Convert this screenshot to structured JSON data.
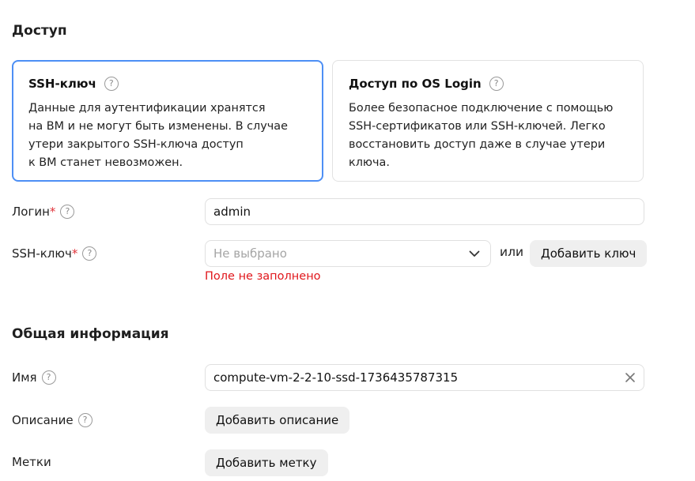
{
  "access": {
    "title": "Доступ",
    "cards": [
      {
        "title": "SSH-ключ",
        "description": "Данные для аутентификации хранятся\nна ВМ и не могут быть изменены. В случае\nутери закрытого SSH-ключа доступ\nк ВМ станет невозможен.",
        "selected": true
      },
      {
        "title": "Доступ по OS Login",
        "description": "Более безопасное подключение с помощью\nSSH-сертификатов или SSH-ключей. Легко\nвосстановить доступ даже в случае утери\nключа.",
        "selected": false
      }
    ],
    "login": {
      "label": "Логин",
      "required_mark": "*",
      "value": "admin"
    },
    "ssh_key": {
      "label": "SSH-ключ",
      "required_mark": "*",
      "placeholder": "Не выбрано",
      "or_text": "или",
      "add_button": "Добавить ключ",
      "error": "Поле не заполнено"
    }
  },
  "general": {
    "title": "Общая информация",
    "name": {
      "label": "Имя",
      "value": "compute-vm-2-2-10-ssd-1736435787315"
    },
    "description": {
      "label": "Описание",
      "button": "Добавить описание"
    },
    "labels": {
      "label": "Метки",
      "button": "Добавить метку"
    }
  },
  "colors": {
    "selected_border": "#4d8ff5",
    "error": "#e0161b",
    "required": "#e0333a",
    "button_bg": "#efefef"
  },
  "icons": {
    "help": "question-circle-icon",
    "dropdown": "chevron-down-icon",
    "clear": "close-icon"
  }
}
